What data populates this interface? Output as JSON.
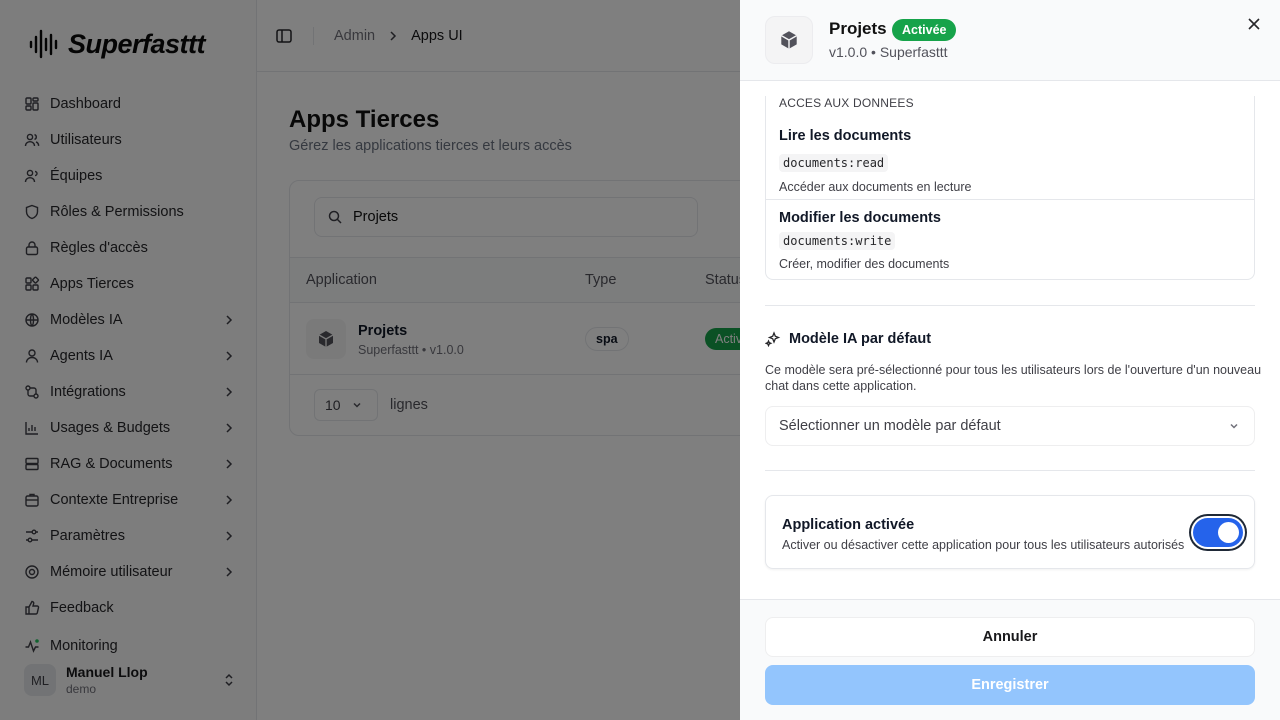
{
  "brand": {
    "name": "Superfasttt"
  },
  "sidebar": {
    "items": [
      {
        "label": "Dashboard",
        "icon": "dashboard-icon",
        "has_submenu": false
      },
      {
        "label": "Utilisateurs",
        "icon": "users-icon",
        "has_submenu": false
      },
      {
        "label": "Équipes",
        "icon": "teams-icon",
        "has_submenu": false
      },
      {
        "label": "Rôles & Permissions",
        "icon": "shield-icon",
        "has_submenu": false
      },
      {
        "label": "Règles d'accès",
        "icon": "lock-icon",
        "has_submenu": false
      },
      {
        "label": "Apps Tierces",
        "icon": "apps-icon",
        "has_submenu": false
      },
      {
        "label": "Modèles IA",
        "icon": "globe-icon",
        "has_submenu": true
      },
      {
        "label": "Agents IA",
        "icon": "agent-icon",
        "has_submenu": true
      },
      {
        "label": "Intégrations",
        "icon": "integrations-icon",
        "has_submenu": true
      },
      {
        "label": "Usages & Budgets",
        "icon": "bar-chart-icon",
        "has_submenu": true
      },
      {
        "label": "RAG & Documents",
        "icon": "database-icon",
        "has_submenu": true
      },
      {
        "label": "Contexte Entreprise",
        "icon": "building-icon",
        "has_submenu": true
      },
      {
        "label": "Paramètres",
        "icon": "sliders-icon",
        "has_submenu": true
      },
      {
        "label": "Mémoire utilisateur",
        "icon": "brain-icon",
        "has_submenu": true
      },
      {
        "label": "Feedback",
        "icon": "thumbs-up-icon",
        "has_submenu": false
      },
      {
        "label": "Monitoring",
        "icon": "activity-icon",
        "has_submenu": false
      }
    ],
    "user": {
      "initials": "ML",
      "name": "Manuel Llop",
      "role": "demo"
    }
  },
  "header": {
    "breadcrumb": [
      "Admin",
      "Apps UI"
    ]
  },
  "page": {
    "title": "Apps Tierces",
    "subtitle": "Gérez les applications tierces et leurs accès"
  },
  "search": {
    "value": "Projets"
  },
  "table": {
    "columns": [
      "Application",
      "Type",
      "Status"
    ],
    "rows": [
      {
        "name": "Projets",
        "subtitle": "Superfasttt • v1.0.0",
        "type": "spa",
        "status": "Activée"
      }
    ]
  },
  "pagination": {
    "page_size": "10",
    "label": "lignes"
  },
  "drawer": {
    "title": "Projets",
    "status": "Activée",
    "subtitle": "v1.0.0 • Superfasttt",
    "permissions_section": "ACCES AUX DONNEES",
    "permissions": [
      {
        "title": "Lire les documents",
        "code": "documents:read",
        "description": "Accéder aux documents en lecture"
      },
      {
        "title": "Modifier les documents",
        "code": "documents:write",
        "description": "Créer, modifier des documents"
      }
    ],
    "model_section": {
      "title": "Modèle IA par défaut",
      "description": "Ce modèle sera pré-sélectionné pour tous les utilisateurs lors de l'ouverture d'un nouveau chat dans cette application.",
      "placeholder": "Sélectionner un modèle par défaut"
    },
    "activation": {
      "title": "Application activée",
      "description": "Activer ou désactiver cette application pour tous les utilisateurs autorisés",
      "enabled": true
    },
    "buttons": {
      "cancel": "Annuler",
      "save": "Enregistrer"
    }
  },
  "colors": {
    "accent": "#2563eb",
    "success": "#16a34a",
    "save_disabled": "#93c5fd"
  }
}
